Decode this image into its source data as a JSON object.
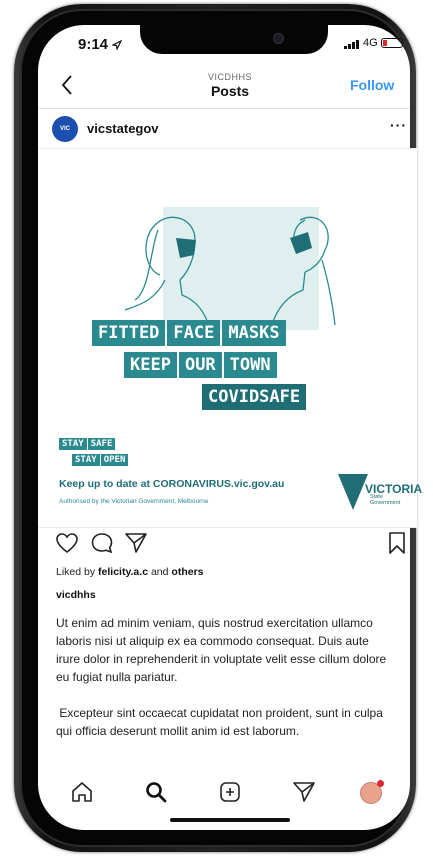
{
  "status_bar": {
    "time": "9:14",
    "network": "4G"
  },
  "nav": {
    "subtitle": "VICDHHS",
    "title": "Posts",
    "follow_label": "Follow"
  },
  "post_header": {
    "avatar_text": "VIC",
    "username": "vicstategov",
    "more": "···"
  },
  "image": {
    "banner_line1": [
      "FITTED",
      "FACE",
      "MASKS"
    ],
    "banner_line2": [
      "KEEP",
      "OUR",
      "TOWN"
    ],
    "banner_line3": [
      "COVIDSAFE"
    ],
    "stay_line1": [
      "STAY",
      "SAFE"
    ],
    "stay_line2": [
      "STAY",
      "OPEN"
    ],
    "cta": "Keep up to date at CORONAVIRUS.vic.gov.au",
    "authorised": "Authorised by the Victorian Government, Melbourne",
    "logo_text": "VICTORIA",
    "logo_sub1": "State",
    "logo_sub2": "Government",
    "teal_color": "#2a8a8f",
    "teal_dark": "#1f6e76"
  },
  "likes": {
    "prefix": "Liked by",
    "user": "felicity.a.c",
    "and": "and",
    "others": "others"
  },
  "caption": {
    "username": "vicdhhs",
    "paragraph1": "Ut enim ad minim veniam, quis nostrud exercitation ullamco laboris nisi ut aliquip ex ea commodo consequat. Duis aute irure dolor in reprehenderit in voluptate velit esse cillum dolore eu fugiat nulla pariatur.",
    "paragraph2": " Excepteur sint occaecat cupidatat non proident, sunt in culpa qui officia deserunt mollit anim id est laborum."
  },
  "tab_bar": {
    "icons": [
      "home-icon",
      "search-icon",
      "add-post-icon",
      "direct-message-icon",
      "profile-icon"
    ]
  }
}
